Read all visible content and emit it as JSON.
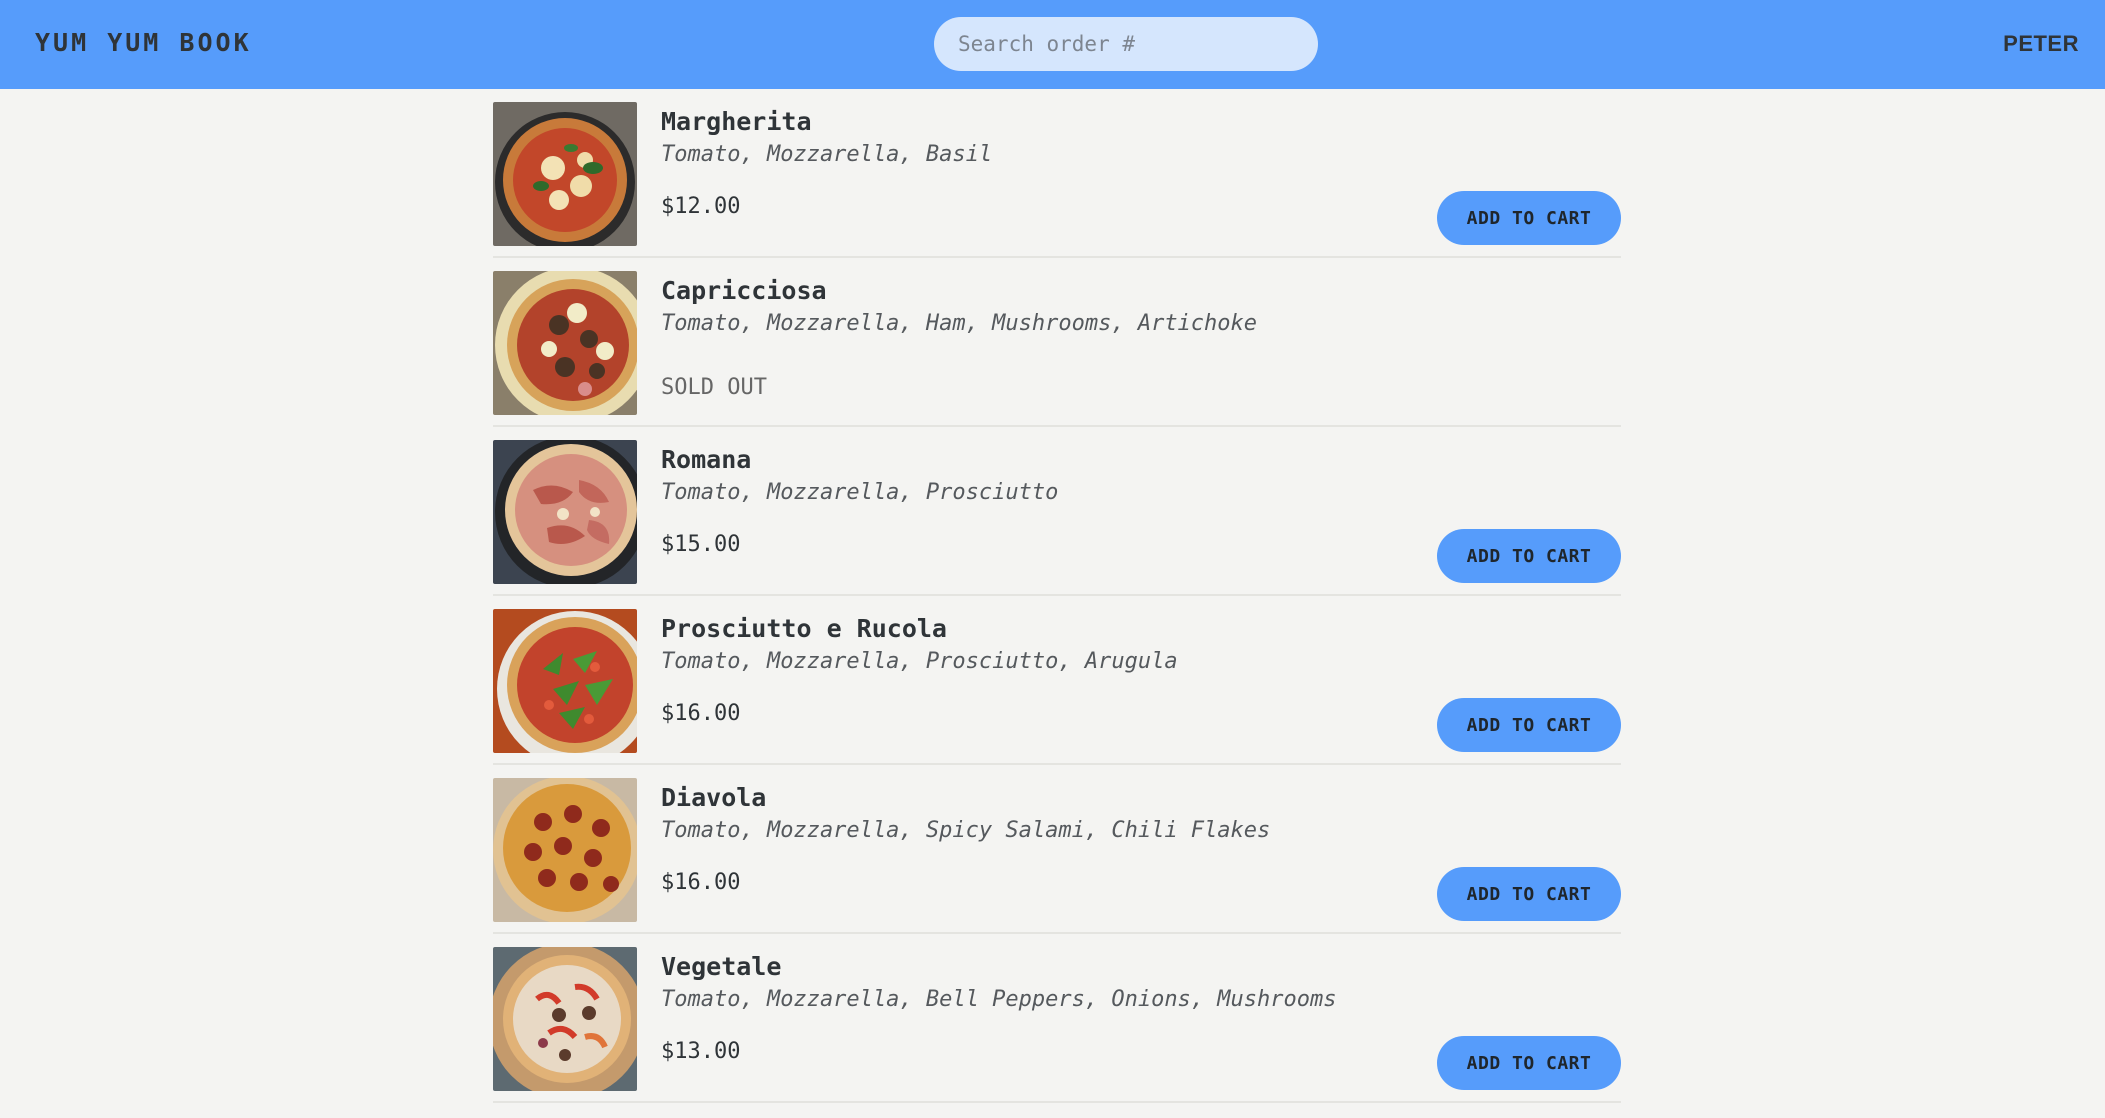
{
  "header": {
    "logo": "YUM YUM BOOK",
    "search_placeholder": "Search order #",
    "user_name": "PETER"
  },
  "menu": {
    "items": [
      {
        "name": "Margherita",
        "ingredients": "Tomato, Mozzarella, Basil",
        "price": "$12.00",
        "status": "",
        "button_label": "ADD TO CART",
        "image_icon": "pizza-margherita-photo"
      },
      {
        "name": "Capricciosa",
        "ingredients": "Tomato, Mozzarella, Ham, Mushrooms, Artichoke",
        "price": "",
        "status": "SOLD OUT",
        "button_label": "",
        "image_icon": "pizza-capricciosa-photo"
      },
      {
        "name": "Romana",
        "ingredients": "Tomato, Mozzarella, Prosciutto",
        "price": "$15.00",
        "status": "",
        "button_label": "ADD TO CART",
        "image_icon": "pizza-romana-photo"
      },
      {
        "name": "Prosciutto e Rucola",
        "ingredients": "Tomato, Mozzarella, Prosciutto, Arugula",
        "price": "$16.00",
        "status": "",
        "button_label": "ADD TO CART",
        "image_icon": "pizza-prosciutto-rucola-photo"
      },
      {
        "name": "Diavola",
        "ingredients": "Tomato, Mozzarella, Spicy Salami, Chili Flakes",
        "price": "$16.00",
        "status": "",
        "button_label": "ADD TO CART",
        "image_icon": "pizza-diavola-photo"
      },
      {
        "name": "Vegetale",
        "ingredients": "Tomato, Mozzarella, Bell Peppers, Onions, Mushrooms",
        "price": "$13.00",
        "status": "",
        "button_label": "ADD TO CART",
        "image_icon": "pizza-vegetale-photo"
      }
    ]
  },
  "colors": {
    "header_bg": "#569cfb",
    "button_bg": "#569cfb",
    "page_bg": "#f4f4f2",
    "search_bg": "#d5e6fd"
  }
}
